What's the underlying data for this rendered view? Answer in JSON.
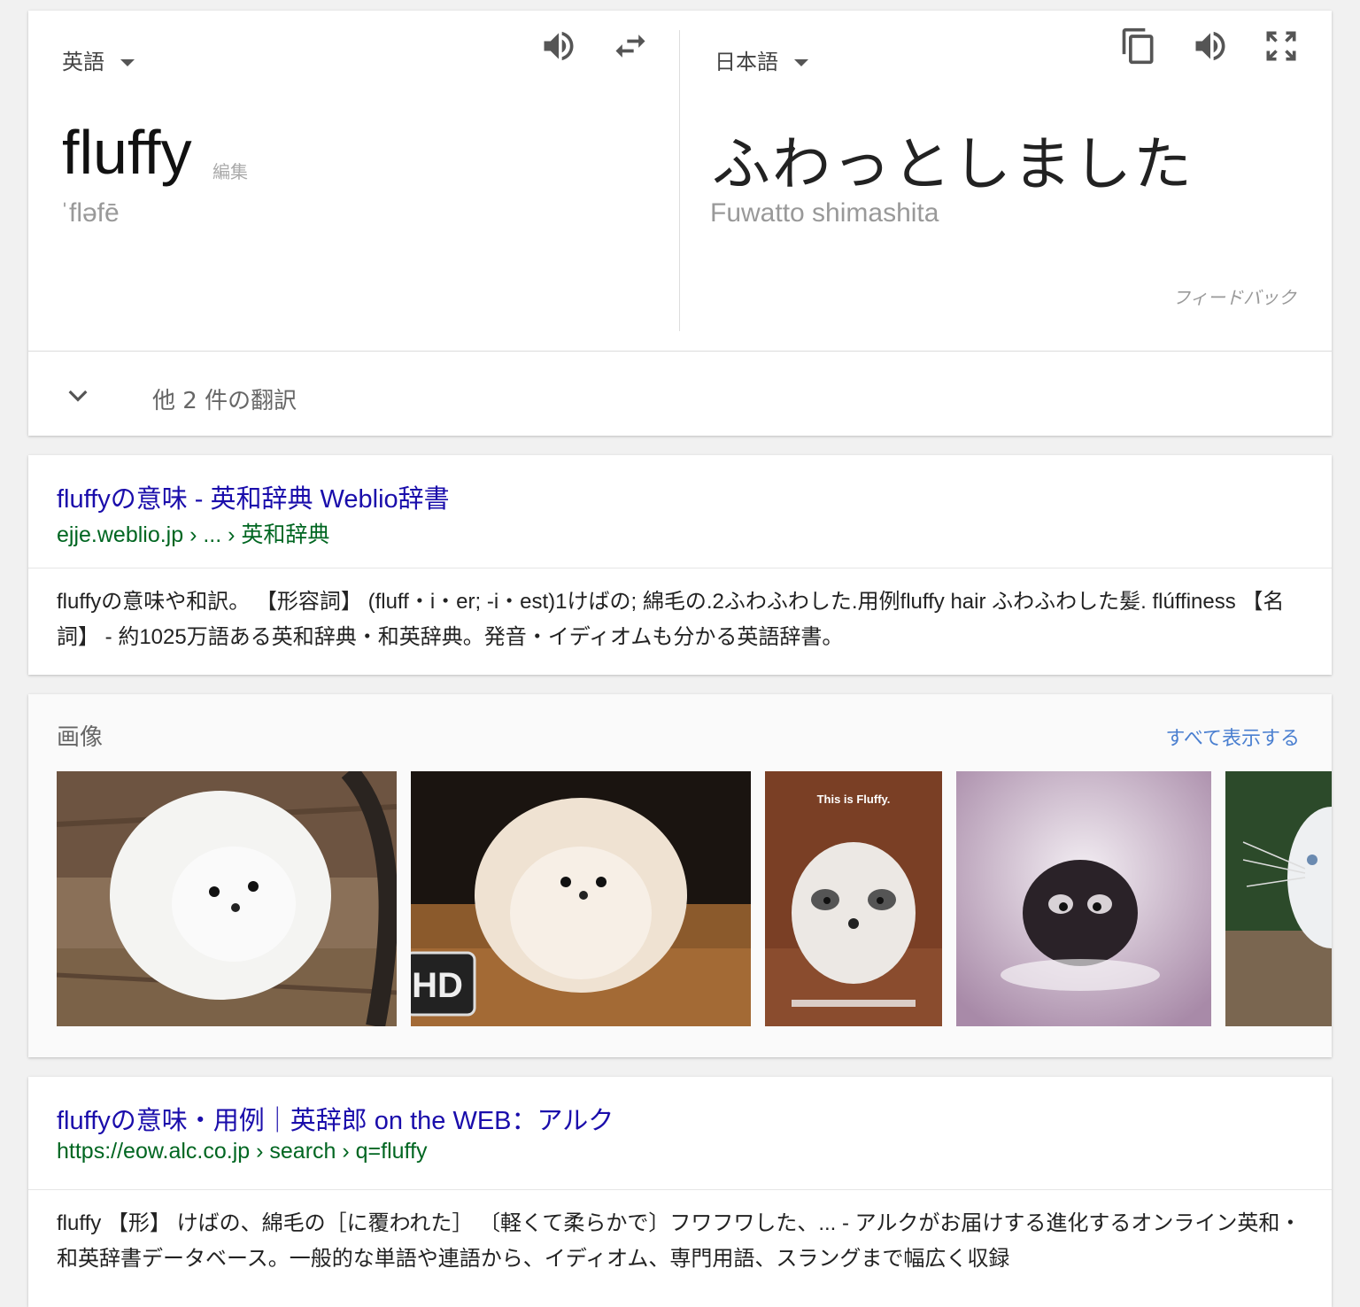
{
  "translate": {
    "source_lang": "英語",
    "target_lang": "日本語",
    "source_word": "fluffy",
    "edit_label": "編集",
    "pronunciation": "ˈfləfē",
    "target_word": "ふわっとしました",
    "romanization": "Fuwatto shimashita",
    "feedback_label": "フィードバック",
    "more_translations": "他 2 件の翻訳",
    "icons": [
      "speaker-icon",
      "swap-icon",
      "copy-icon",
      "speaker-icon",
      "fullscreen-icon",
      "chevron-down-icon"
    ]
  },
  "results": [
    {
      "title": "fluffyの意味 - 英和辞典 Weblio辞書",
      "url": "ejje.weblio.jp › ... › 英和辞典",
      "snippet": "fluffyの意味や和訳。 【形容詞】 (fluff・i・er; -i・est)1けばの; 綿毛の.2ふわふわした.用例fluffy hair ふわふわした髪. flúffiness 【名詞】 - 約1025万語ある英和辞典・和英辞典。発音・イディオムも分かる英語辞書。"
    },
    {
      "title": "fluffyの意味・用例｜英辞郎 on the WEB：アルク",
      "url": "https://eow.alc.co.jp › search › q=fluffy",
      "snippet": "fluffy 【形】 けばの、綿毛の［に覆われた］ 〔軽くて柔らかで〕フワフワした、... - アルクがお届けする進化するオンライン英和・和英辞書データベース。一般的な単語や連語から、イディオム、専門用語、スラングまで幅広く収録"
    }
  ],
  "images": {
    "label": "画像",
    "see_all": "すべて表示する",
    "thumbnails": [
      {
        "name": "white-pomeranian-on-bench",
        "text": ""
      },
      {
        "name": "cream-pomeranian-puppy",
        "text": "HD"
      },
      {
        "name": "this-is-fluffy-puppy-meme",
        "text": "This is Fluffy."
      },
      {
        "name": "black-fluffball-creature",
        "text": ""
      },
      {
        "name": "white-kitten-partial",
        "text": ""
      }
    ]
  },
  "colors": {
    "link": "#1a0dab",
    "url": "#006621",
    "see_all": "#4a7fd0"
  }
}
